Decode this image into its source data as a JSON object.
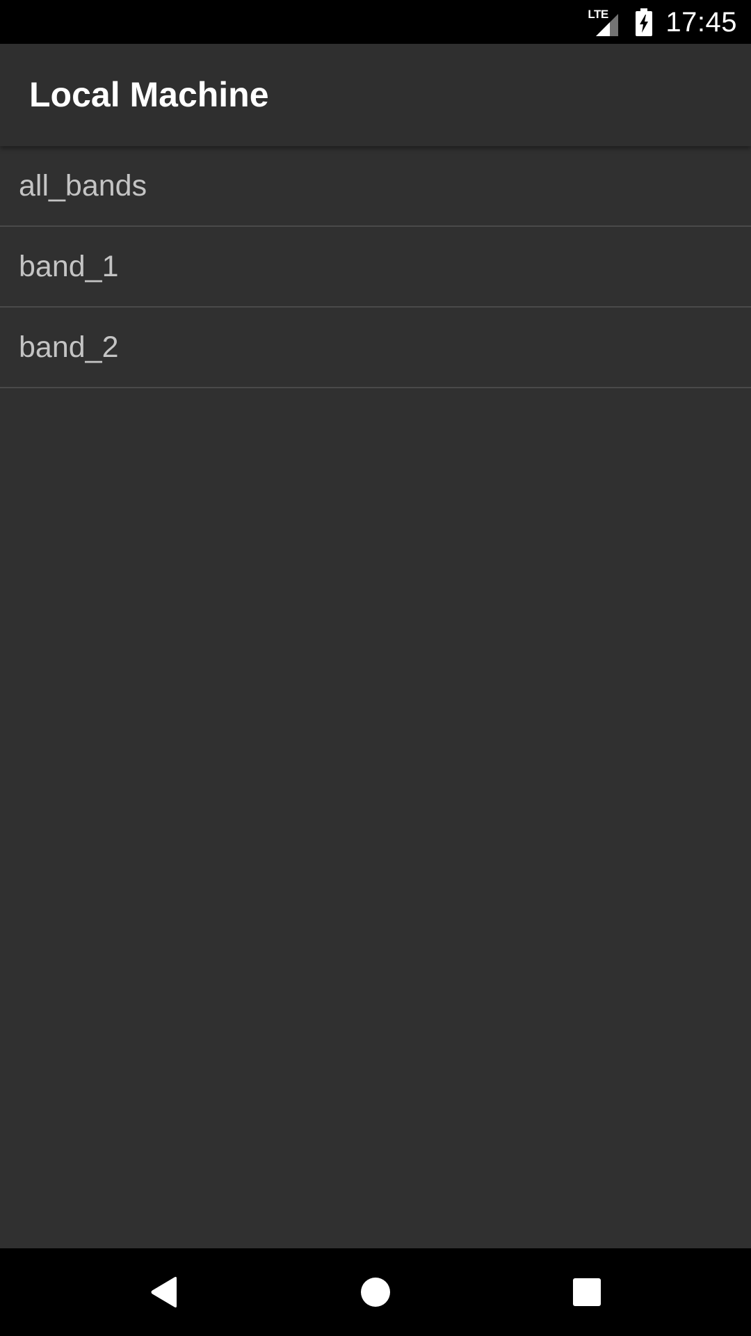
{
  "status_bar": {
    "network_label": "LTE",
    "time": "17:45",
    "icons": [
      "lte-signal-icon",
      "battery-charging-icon"
    ]
  },
  "app_bar": {
    "title": "Local Machine"
  },
  "list": {
    "items": [
      {
        "label": "all_bands"
      },
      {
        "label": "band_1"
      },
      {
        "label": "band_2"
      }
    ]
  },
  "nav_bar": {
    "icons": [
      "back-icon",
      "home-icon",
      "recents-icon"
    ]
  },
  "colors": {
    "background": "#303030",
    "app_bar": "#2f2f2f",
    "system_bars": "#000000",
    "title_text": "#ffffff",
    "item_text": "#c4c4c4",
    "divider": "#4a4a4a"
  }
}
